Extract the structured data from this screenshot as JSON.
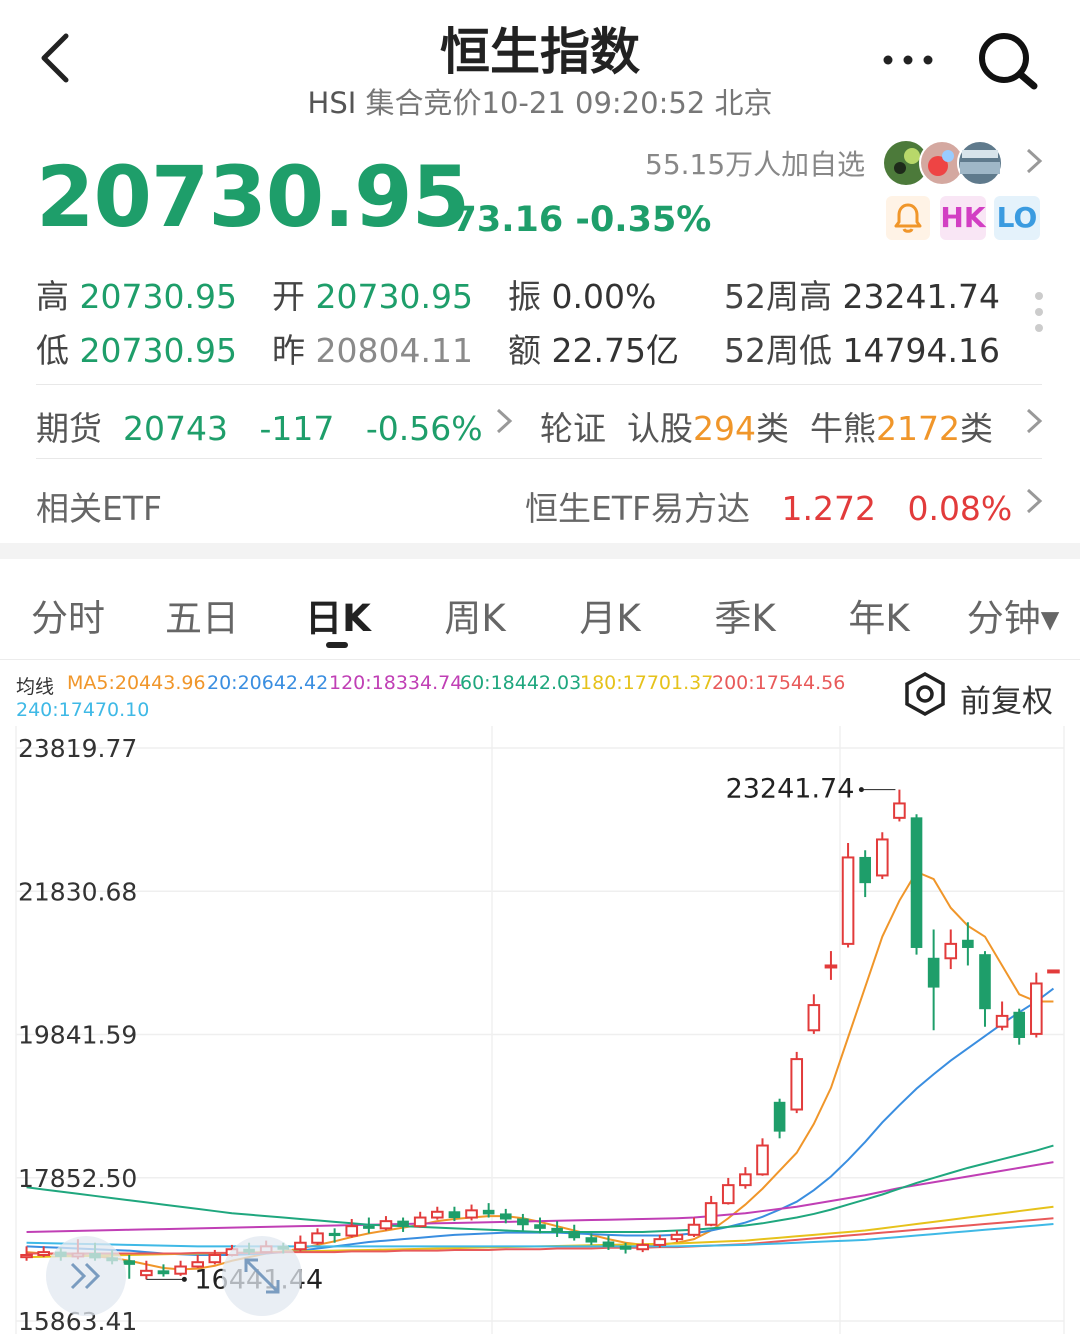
{
  "header": {
    "title": "恒生指数",
    "code": "HSI",
    "status": "集合竞价10-21 09:20:52 北京"
  },
  "quote": {
    "price": "20730.95",
    "change": "-73.16",
    "change_pct": "-0.35%",
    "watchers": "55.15万人加自选",
    "badges": {
      "hk": "HK",
      "lo": "LO"
    }
  },
  "stats": [
    {
      "label": "高",
      "value": "20730.95"
    },
    {
      "label": "开",
      "value": "20730.95"
    },
    {
      "label": "振",
      "value": "0.00%"
    },
    {
      "label": "52周高",
      "value": "23241.74"
    },
    {
      "label": "低",
      "value": "20730.95"
    },
    {
      "label": "昨",
      "value": "20804.11"
    },
    {
      "label": "额",
      "value": "22.75亿"
    },
    {
      "label": "52周低",
      "value": "14794.16"
    }
  ],
  "futures": {
    "label": "期货",
    "price": "20743",
    "change": "-117",
    "change_pct": "-0.56%"
  },
  "warrants": {
    "label": "轮证",
    "call_label": "认股",
    "call_count": "294",
    "bull_label": "牛熊",
    "bull_count": "2172",
    "unit": "类"
  },
  "etf": {
    "label": "相关ETF",
    "name": "恒生ETF易方达",
    "price": "1.272",
    "change_pct": "0.08%"
  },
  "tabs": [
    "分时",
    "五日",
    "日K",
    "周K",
    "月K",
    "季K",
    "年K",
    "分钟▾"
  ],
  "active_tab": "日K",
  "ma_legend": {
    "title": "均线",
    "items": [
      {
        "label": "MA5:20443.96",
        "color": "#f0962a"
      },
      {
        "label": "20:20642.42",
        "color": "#3a8ee0"
      },
      {
        "label": "120:18334.74",
        "color": "#c03fb5"
      },
      {
        "label": "60:18442.03",
        "color": "#1fa77e"
      },
      {
        "label": "180:17701.37",
        "color": "#e6c21b"
      },
      {
        "label": "200:17544.56",
        "color": "#e85a5a"
      },
      {
        "label": "240:17470.10",
        "color": "#3fb9e6"
      }
    ]
  },
  "adjust_label": "前复权",
  "colors": {
    "up": "#e23b3b",
    "down": "#1e9e6a",
    "accent_orange": "#f0962a"
  },
  "chart_data": {
    "type": "candlestick",
    "ylabels": [
      "23819.77",
      "21830.68",
      "19841.59",
      "17852.50",
      "15863.41"
    ],
    "ylim": [
      15863.41,
      23819.77
    ],
    "max_annotation": "23241.74",
    "min_annotation": "16441.44",
    "candles": [
      {
        "o": 16750,
        "c": 16780,
        "h": 16900,
        "l": 16700
      },
      {
        "o": 16780,
        "c": 16820,
        "h": 16900,
        "l": 16750
      },
      {
        "o": 16820,
        "c": 16760,
        "h": 16880,
        "l": 16700
      },
      {
        "o": 16760,
        "c": 16800,
        "h": 17000,
        "l": 16720
      },
      {
        "o": 16800,
        "c": 16740,
        "h": 16950,
        "l": 16700
      },
      {
        "o": 16740,
        "c": 16700,
        "h": 16850,
        "l": 16650
      },
      {
        "o": 16700,
        "c": 16650,
        "h": 16780,
        "l": 16450
      },
      {
        "o": 16500,
        "c": 16560,
        "h": 16700,
        "l": 16441.44
      },
      {
        "o": 16560,
        "c": 16520,
        "h": 16650,
        "l": 16480
      },
      {
        "o": 16520,
        "c": 16620,
        "h": 16700,
        "l": 16490
      },
      {
        "o": 16620,
        "c": 16680,
        "h": 16780,
        "l": 16600
      },
      {
        "o": 16680,
        "c": 16780,
        "h": 16850,
        "l": 16650
      },
      {
        "o": 16780,
        "c": 16860,
        "h": 16920,
        "l": 16760
      },
      {
        "o": 16860,
        "c": 16820,
        "h": 16950,
        "l": 16780
      },
      {
        "o": 16820,
        "c": 16900,
        "h": 16980,
        "l": 16800
      },
      {
        "o": 16900,
        "c": 16860,
        "h": 16950,
        "l": 16800
      },
      {
        "o": 16860,
        "c": 16950,
        "h": 17050,
        "l": 16830
      },
      {
        "o": 16950,
        "c": 17080,
        "h": 17150,
        "l": 16920
      },
      {
        "o": 17080,
        "c": 17050,
        "h": 17150,
        "l": 16950
      },
      {
        "o": 17050,
        "c": 17180,
        "h": 17280,
        "l": 17020
      },
      {
        "o": 17180,
        "c": 17150,
        "h": 17300,
        "l": 17080
      },
      {
        "o": 17150,
        "c": 17250,
        "h": 17320,
        "l": 17120
      },
      {
        "o": 17250,
        "c": 17180,
        "h": 17300,
        "l": 17100
      },
      {
        "o": 17180,
        "c": 17300,
        "h": 17380,
        "l": 17160
      },
      {
        "o": 17300,
        "c": 17380,
        "h": 17450,
        "l": 17270
      },
      {
        "o": 17380,
        "c": 17300,
        "h": 17450,
        "l": 17250
      },
      {
        "o": 17300,
        "c": 17400,
        "h": 17480,
        "l": 17260
      },
      {
        "o": 17400,
        "c": 17350,
        "h": 17500,
        "l": 17300
      },
      {
        "o": 17350,
        "c": 17280,
        "h": 17420,
        "l": 17220
      },
      {
        "o": 17280,
        "c": 17200,
        "h": 17350,
        "l": 17120
      },
      {
        "o": 17200,
        "c": 17150,
        "h": 17300,
        "l": 17080
      },
      {
        "o": 17150,
        "c": 17100,
        "h": 17250,
        "l": 17030
      },
      {
        "o": 17100,
        "c": 17020,
        "h": 17200,
        "l": 16980
      },
      {
        "o": 17020,
        "c": 16960,
        "h": 17080,
        "l": 16920
      },
      {
        "o": 16960,
        "c": 16900,
        "h": 17050,
        "l": 16850
      },
      {
        "o": 16900,
        "c": 16860,
        "h": 16950,
        "l": 16800
      },
      {
        "o": 16860,
        "c": 16920,
        "h": 17000,
        "l": 16820
      },
      {
        "o": 16920,
        "c": 17000,
        "h": 17060,
        "l": 16880
      },
      {
        "o": 17000,
        "c": 17060,
        "h": 17120,
        "l": 16960
      },
      {
        "o": 17060,
        "c": 17200,
        "h": 17300,
        "l": 17030
      },
      {
        "o": 17200,
        "c": 17500,
        "h": 17600,
        "l": 17180
      },
      {
        "o": 17500,
        "c": 17750,
        "h": 17850,
        "l": 17480
      },
      {
        "o": 17750,
        "c": 17900,
        "h": 18000,
        "l": 17700
      },
      {
        "o": 17900,
        "c": 18300,
        "h": 18400,
        "l": 17880
      },
      {
        "o": 18900,
        "c": 18500,
        "h": 18950,
        "l": 18400
      },
      {
        "o": 18800,
        "c": 19500,
        "h": 19600,
        "l": 18750
      },
      {
        "o": 19900,
        "c": 20250,
        "h": 20400,
        "l": 19850
      },
      {
        "o": 20800,
        "c": 20800,
        "h": 21000,
        "l": 20600
      },
      {
        "o": 21100,
        "c": 22300,
        "h": 22500,
        "l": 21050
      },
      {
        "o": 22300,
        "c": 21950,
        "h": 22400,
        "l": 21750
      },
      {
        "o": 22050,
        "c": 22550,
        "h": 22650,
        "l": 22000
      },
      {
        "o": 22850,
        "c": 23050,
        "h": 23241.74,
        "l": 22800
      },
      {
        "o": 22850,
        "c": 21050,
        "h": 22900,
        "l": 20950
      },
      {
        "o": 20900,
        "c": 20500,
        "h": 21300,
        "l": 19900
      },
      {
        "o": 20900,
        "c": 21100,
        "h": 21300,
        "l": 20750
      },
      {
        "o": 21150,
        "c": 21050,
        "h": 21400,
        "l": 20800
      },
      {
        "o": 20950,
        "c": 20200,
        "h": 21000,
        "l": 19950
      },
      {
        "o": 19950,
        "c": 20100,
        "h": 20300,
        "l": 19900
      },
      {
        "o": 20150,
        "c": 19800,
        "h": 20200,
        "l": 19700
      },
      {
        "o": 19850,
        "c": 20550,
        "h": 20700,
        "l": 19800
      },
      {
        "o": 20730.95,
        "c": 20730.95,
        "h": 20730.95,
        "l": 20730.95
      }
    ],
    "ma_lines": [
      {
        "name": "MA5",
        "color": "#f0962a",
        "values": [
          16820,
          16800,
          16790,
          16780,
          16760,
          16740,
          16700,
          16650,
          16600,
          16580,
          16590,
          16630,
          16700,
          16750,
          16800,
          16830,
          16870,
          16920,
          16970,
          17030,
          17080,
          17120,
          17160,
          17200,
          17250,
          17280,
          17300,
          17320,
          17320,
          17290,
          17240,
          17180,
          17120,
          17060,
          17000,
          16950,
          16920,
          16920,
          16950,
          17000,
          17120,
          17290,
          17480,
          17700,
          17950,
          18200,
          18600,
          19100,
          19800,
          20500,
          21200,
          21700,
          22100,
          22000,
          21600,
          21350,
          21200,
          20800,
          20400,
          20300,
          20300
        ]
      },
      {
        "name": "20",
        "color": "#3a8ee0",
        "values": [
          16900,
          16890,
          16880,
          16870,
          16860,
          16850,
          16840,
          16820,
          16800,
          16790,
          16780,
          16780,
          16780,
          16790,
          16800,
          16820,
          16840,
          16870,
          16900,
          16930,
          16960,
          16980,
          17000,
          17020,
          17040,
          17060,
          17070,
          17080,
          17090,
          17090,
          17090,
          17090,
          17080,
          17070,
          17060,
          17050,
          17050,
          17050,
          17060,
          17080,
          17120,
          17170,
          17230,
          17310,
          17410,
          17520,
          17680,
          17870,
          18100,
          18350,
          18620,
          18860,
          19090,
          19290,
          19480,
          19650,
          19820,
          19990,
          20150,
          20300,
          20480
        ]
      },
      {
        "name": "120",
        "color": "#c03fb5",
        "values": [
          17100,
          17105,
          17110,
          17115,
          17120,
          17125,
          17130,
          17135,
          17140,
          17145,
          17150,
          17155,
          17160,
          17165,
          17170,
          17175,
          17180,
          17185,
          17190,
          17195,
          17200,
          17205,
          17210,
          17215,
          17220,
          17225,
          17230,
          17235,
          17240,
          17245,
          17250,
          17255,
          17260,
          17265,
          17270,
          17275,
          17280,
          17285,
          17290,
          17300,
          17320,
          17340,
          17360,
          17390,
          17420,
          17450,
          17490,
          17530,
          17570,
          17610,
          17660,
          17710,
          17750,
          17790,
          17830,
          17870,
          17910,
          17950,
          17990,
          18030,
          18070
        ]
      },
      {
        "name": "60",
        "color": "#1fa77e",
        "values": [
          17720,
          17690,
          17660,
          17630,
          17600,
          17570,
          17540,
          17510,
          17480,
          17450,
          17420,
          17390,
          17360,
          17340,
          17320,
          17300,
          17280,
          17260,
          17240,
          17220,
          17200,
          17190,
          17180,
          17170,
          17160,
          17150,
          17140,
          17130,
          17120,
          17110,
          17100,
          17100,
          17100,
          17100,
          17100,
          17100,
          17100,
          17110,
          17120,
          17130,
          17150,
          17170,
          17190,
          17220,
          17260,
          17300,
          17350,
          17410,
          17480,
          17550,
          17620,
          17700,
          17780,
          17850,
          17920,
          17990,
          18050,
          18110,
          18170,
          18230,
          18300
        ]
      },
      {
        "name": "180",
        "color": "#e6c21b",
        "values": [
          16750,
          16755,
          16760,
          16765,
          16770,
          16775,
          16780,
          16785,
          16790,
          16795,
          16800,
          16805,
          16810,
          16815,
          16820,
          16825,
          16830,
          16835,
          16840,
          16845,
          16850,
          16855,
          16860,
          16865,
          16870,
          16875,
          16880,
          16885,
          16890,
          16895,
          16900,
          16905,
          16910,
          16915,
          16920,
          16925,
          16930,
          16935,
          16940,
          16950,
          16960,
          16970,
          16980,
          17000,
          17020,
          17040,
          17060,
          17080,
          17100,
          17120,
          17150,
          17180,
          17210,
          17240,
          17270,
          17300,
          17330,
          17360,
          17390,
          17420,
          17450
        ]
      },
      {
        "name": "200",
        "color": "#e85a5a",
        "values": [
          16800,
          16800,
          16800,
          16800,
          16800,
          16800,
          16800,
          16800,
          16800,
          16800,
          16810,
          16810,
          16810,
          16810,
          16810,
          16820,
          16820,
          16820,
          16820,
          16830,
          16830,
          16830,
          16840,
          16840,
          16840,
          16850,
          16850,
          16850,
          16860,
          16860,
          16860,
          16870,
          16870,
          16870,
          16880,
          16880,
          16880,
          16890,
          16890,
          16900,
          16910,
          16920,
          16930,
          16950,
          16970,
          16990,
          17010,
          17030,
          17050,
          17070,
          17090,
          17110,
          17130,
          17150,
          17170,
          17190,
          17210,
          17230,
          17250,
          17270,
          17290
        ]
      },
      {
        "name": "240",
        "color": "#3fb9e6",
        "values": [
          16950,
          16945,
          16940,
          16935,
          16930,
          16925,
          16920,
          16915,
          16910,
          16905,
          16900,
          16900,
          16900,
          16900,
          16900,
          16900,
          16900,
          16900,
          16900,
          16900,
          16900,
          16900,
          16900,
          16900,
          16900,
          16900,
          16900,
          16900,
          16900,
          16900,
          16900,
          16900,
          16900,
          16900,
          16900,
          16900,
          16900,
          16900,
          16900,
          16905,
          16910,
          16915,
          16920,
          16930,
          16940,
          16950,
          16960,
          16970,
          16980,
          16990,
          17010,
          17030,
          17050,
          17070,
          17090,
          17110,
          17130,
          17150,
          17170,
          17190,
          17210
        ]
      }
    ]
  }
}
